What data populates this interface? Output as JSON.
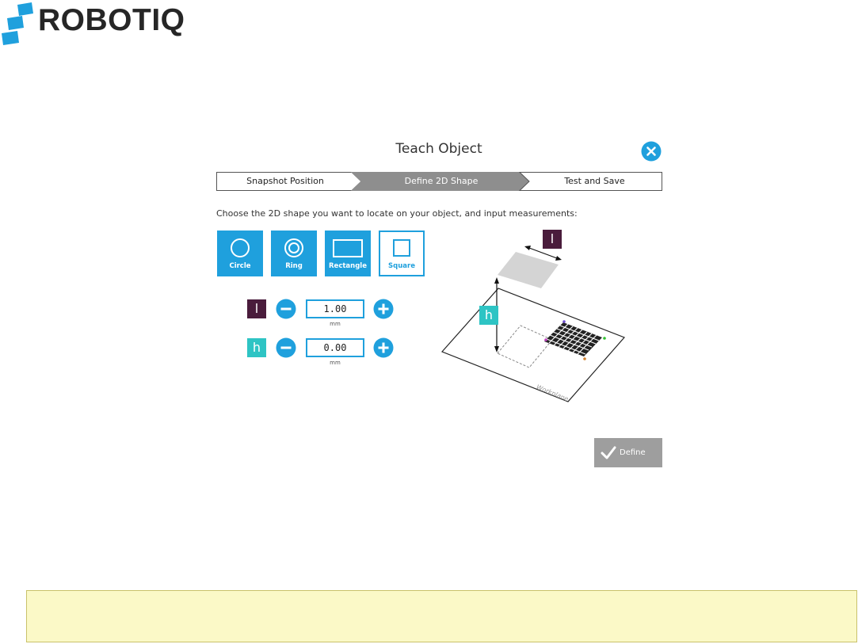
{
  "brand": {
    "name": "ROBOTIQ"
  },
  "dialog": {
    "title": "Teach Object",
    "steps": [
      {
        "label": "Snapshot Position",
        "state": "done"
      },
      {
        "label": "Define 2D Shape",
        "state": "active"
      },
      {
        "label": "Test and Save",
        "state": "todo"
      }
    ],
    "instruction": "Choose the 2D shape you want to locate on your object, and input measurements:",
    "shapes": [
      {
        "label": "Circle",
        "icon": "circle-icon",
        "selected": false
      },
      {
        "label": "Ring",
        "icon": "ring-icon",
        "selected": false
      },
      {
        "label": "Rectangle",
        "icon": "rectangle-icon",
        "selected": false
      },
      {
        "label": "Square",
        "icon": "square-icon",
        "selected": true
      }
    ],
    "measurements": [
      {
        "symbol": "l",
        "value": "1.00",
        "unit": "mm",
        "color": "#4a1c3c"
      },
      {
        "symbol": "h",
        "value": "0.00",
        "unit": "mm",
        "color": "#2ec4c4"
      }
    ],
    "illustration": {
      "length_badge": "l",
      "height_badge": "h",
      "plane_label": "Workplane"
    },
    "define_label": "Define"
  },
  "colors": {
    "accent": "#1fa0dd",
    "step_active": "#8e8e8e",
    "define_button": "#9e9e9e",
    "note_bg": "#fbf9c7",
    "note_border": "#c9c26a"
  }
}
